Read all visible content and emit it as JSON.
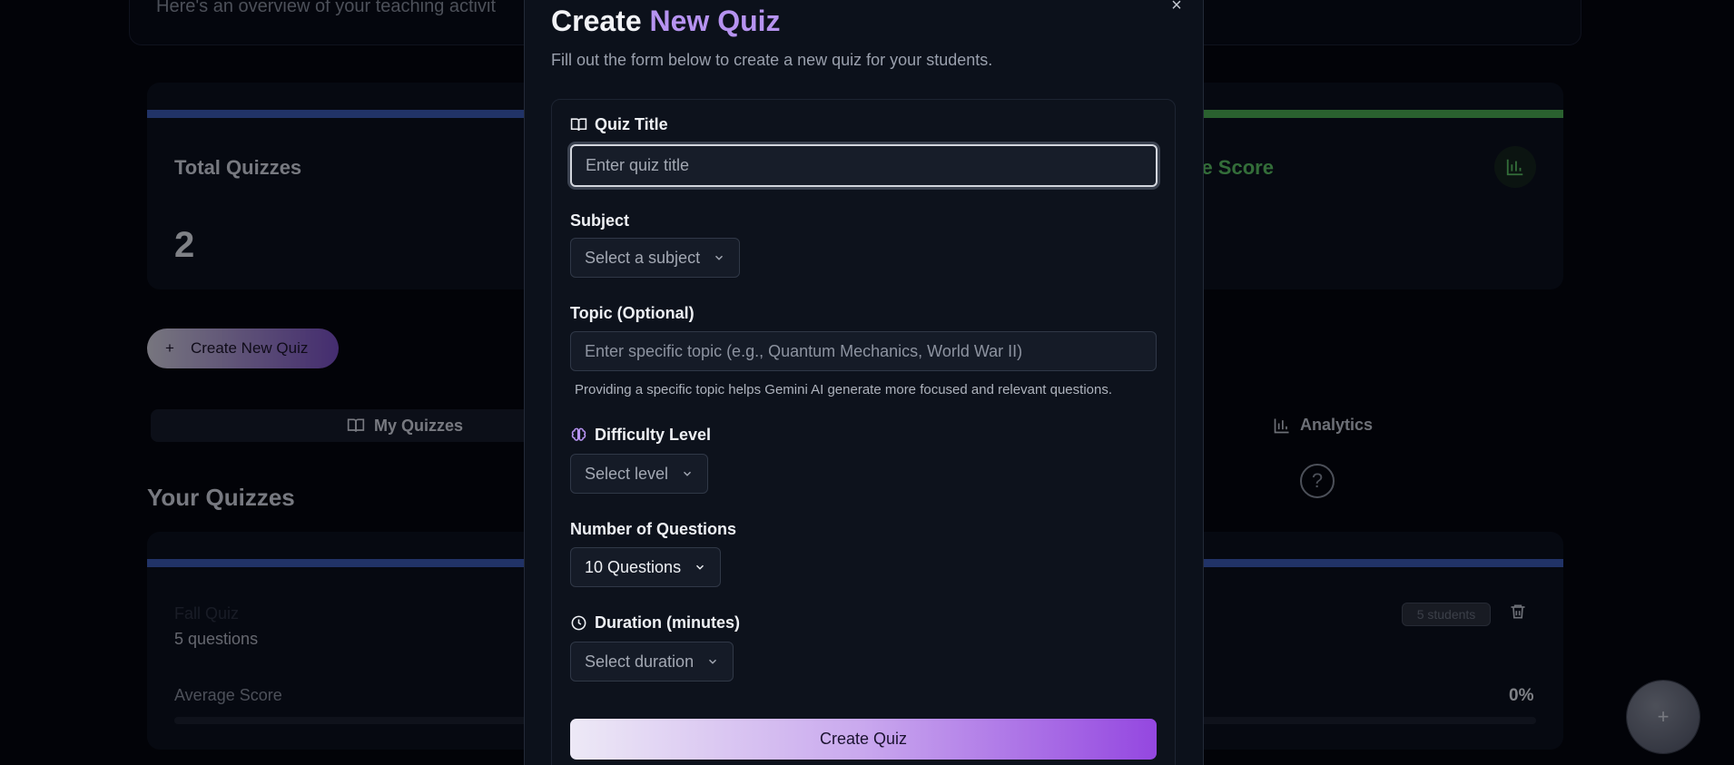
{
  "background": {
    "welcome_text": "Here's an overview of your teaching activit",
    "stats": {
      "total_quizzes_label": "Total Quizzes",
      "total_quizzes_value": "2",
      "average_score_label_partial": "ge Score"
    },
    "create_button_label": "Create New Quiz",
    "tabs": {
      "my_quizzes": "My Quizzes",
      "analytics": "Analytics"
    },
    "section_title": "Your Quizzes",
    "quiz_card": {
      "title": "Fall Quiz",
      "question_count": "5 questions",
      "students_badge": "5 students",
      "average_score_label": "Average Score",
      "average_score_value": "0%",
      "average_score_fraction": 0
    }
  },
  "modal": {
    "title_plain": "Create ",
    "title_accent": "New Quiz",
    "description": "Fill out the form below to create a new quiz for your students.",
    "close_symbol": "×",
    "quiz_title": {
      "label": "Quiz Title",
      "placeholder": "Enter quiz title"
    },
    "subject": {
      "label": "Subject",
      "value": "Select a subject"
    },
    "topic": {
      "label": "Topic (Optional)",
      "placeholder": "Enter specific topic (e.g., Quantum Mechanics, World War II)",
      "hint": "Providing a specific topic helps Gemini AI generate more focused and relevant questions."
    },
    "difficulty": {
      "label": "Difficulty Level",
      "value": "Select level"
    },
    "num_questions": {
      "label": "Number of Questions",
      "value": "10 Questions"
    },
    "duration": {
      "label": "Duration (minutes)",
      "value": "Select duration"
    },
    "submit_label": "Create Quiz"
  },
  "colors": {
    "accent_purple": "#b693f0",
    "stat_blue": "#3b5bb5",
    "stat_green": "#4caf50"
  }
}
